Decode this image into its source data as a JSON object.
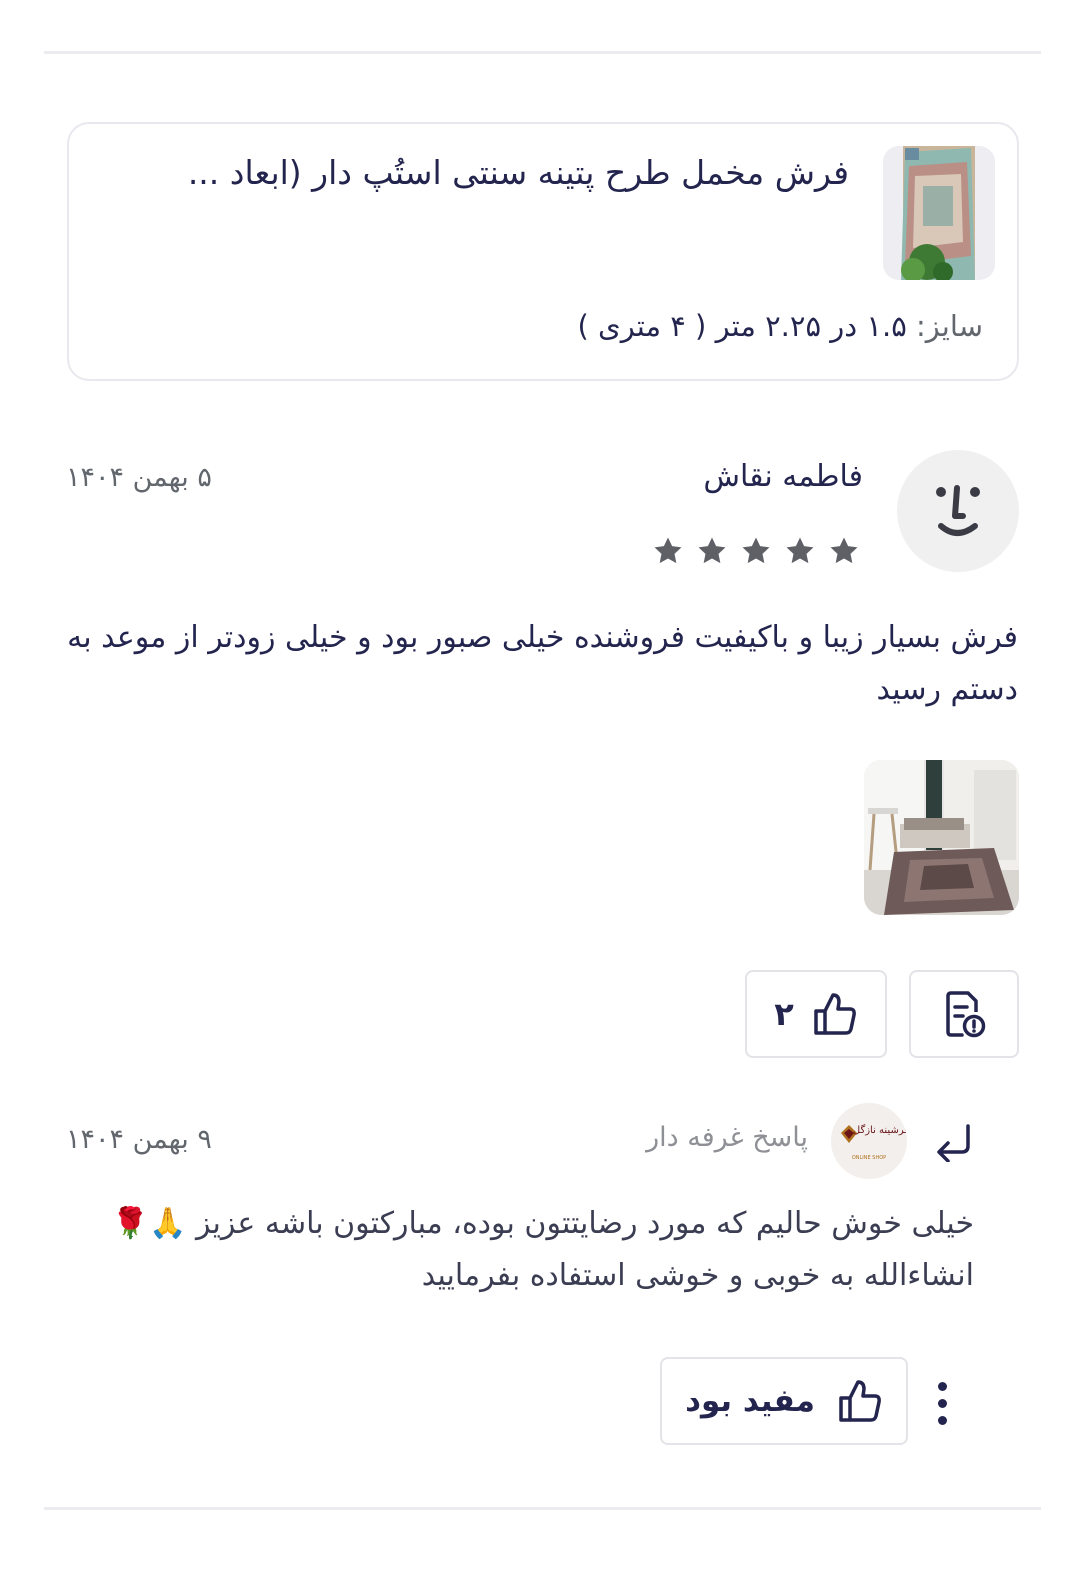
{
  "product": {
    "title": "فرش مخمل طرح پتینه سنتی استُپ دار (ابعاد ...",
    "size_label": "سایز:",
    "size_value": " ۱.۵ در ۲.۲۵ متر ( ۴ متری )",
    "thumbnail_icon": "rug-product-image"
  },
  "review": {
    "reviewer_name": "فاطمه نقاش",
    "date": "۵ بهمن ۱۴۰۴",
    "rating": 5,
    "rating_max": 5,
    "body": "فرش بسیار زیبا و باکیفیت فروشنده خیلی صبور بود و خیلی زودتر از موعد به دستم رسید",
    "photo_icon": "customer-room-photo",
    "like_count": "۲",
    "avatar_icon": "face-avatar-icon"
  },
  "reply": {
    "label": "پاسخ غرفه دار",
    "date": "۹ بهمن ۱۴۰۴",
    "body": "خیلی خوش حالیم که مورد رضایتتون بوده، مبارکتون باشه عزیز 🙏🌹 انشاءالله به خوبی و خوشی استفاده بفرمایید",
    "shop_logo_text": "فرشینه نازگل",
    "shop_logo_subtext": "ONLINE SHOP",
    "helpful_label": "مفید بود"
  },
  "colors": {
    "text_primary": "#23254e",
    "text_secondary": "#62666d",
    "star": "#5e6066",
    "border": "#e3e3e8"
  }
}
